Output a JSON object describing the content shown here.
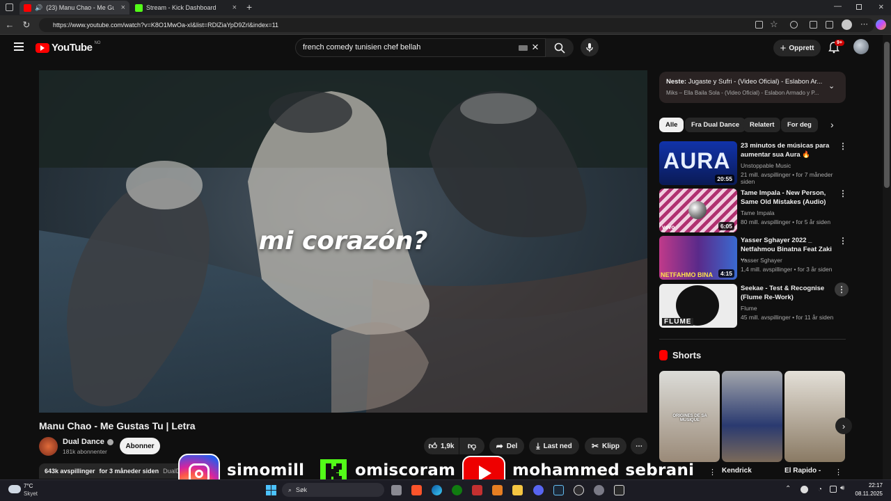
{
  "browser": {
    "tabs": [
      {
        "label": "(23) Manu Chao - Me Gusta"
      },
      {
        "label": "Stream - Kick Dashboard"
      }
    ],
    "url": "https://www.youtube.com/watch?v=K8O1MwOa-xI&list=RDlZiaYpD9Zrl&index=11"
  },
  "masthead": {
    "logo": "YouTube",
    "region": "NO",
    "search_value": "french comedy tunisien chef bellah",
    "create_label": "Opprett",
    "notif_badge": "9+"
  },
  "player": {
    "lyric": "mi corazón?"
  },
  "video": {
    "title": "Manu Chao - Me Gustas Tu | Letra",
    "channel": "Dual Dance",
    "subscribers": "181k abonnenter",
    "subscribe_label": "Abonner",
    "likes": "1,9k",
    "share_label": "Del",
    "download_label": "Last ned",
    "clip_label": "Klipp",
    "views": "643k avspillinger",
    "age": "for 3 måneder siden",
    "desc_start": "DualD"
  },
  "upnext": {
    "prefix": "Neste:",
    "title": "Jugaste y Sufri - (Video Oficial) - Eslabon Ar...",
    "mix": "Miks – Ella Baila Sola - (Video Oficial) - Eslabon Armado y P..."
  },
  "chips": [
    "Alle",
    "Fra Dual Dance",
    "Relatert",
    "For deg"
  ],
  "related": [
    {
      "title": "23 minutos de músicas para aumentar sua Aura 🔥",
      "channel": "Unstoppable Music",
      "meta": "21 mill. avspillinger • for 7 måneder siden",
      "duration": "20:55",
      "thumb_text": "AURA"
    },
    {
      "title": "Tame Impala - New Person, Same Old Mistakes (Audio)",
      "channel": "Tame Impala",
      "meta": "80 mill. avspillinger • for 5 år siden",
      "duration": "6:05",
      "thumb_text": "vevo"
    },
    {
      "title": "Yasser Sghayer 2022 _ Netfahmou Binatna Feat Zaki ...",
      "channel": "Yasser Sghayer",
      "meta": "1,4 mill. avspillinger • for 3 år siden",
      "duration": "4:15",
      "thumb_text": "NETFAHMO BINA"
    },
    {
      "title": "Seekae - Test & Recognise (Flume Re-Work)",
      "channel": "Flume",
      "meta": "45 mill. avspillinger • for 11 år siden",
      "duration": "",
      "thumb_text": "FLUME"
    }
  ],
  "shorts": {
    "heading": "Shorts",
    "items": [
      {
        "title": "",
        "thumb_text": "ORIGINES DE SA MUSIQUE"
      },
      {
        "title": "Kendrick"
      },
      {
        "title": "El Rapido -"
      }
    ]
  },
  "overlay": {
    "instagram": "simomill",
    "kick": "omiscoram",
    "youtube": "mohammed sebrani"
  },
  "taskbar": {
    "temp": "7°C",
    "weather": "Skyet",
    "search_label": "Søk",
    "time": "22:17",
    "date": "08.11.2025"
  },
  "colors": {
    "yt_red": "#ff0000",
    "kick_green": "#53fc18",
    "bg": "#0f0f0f"
  }
}
